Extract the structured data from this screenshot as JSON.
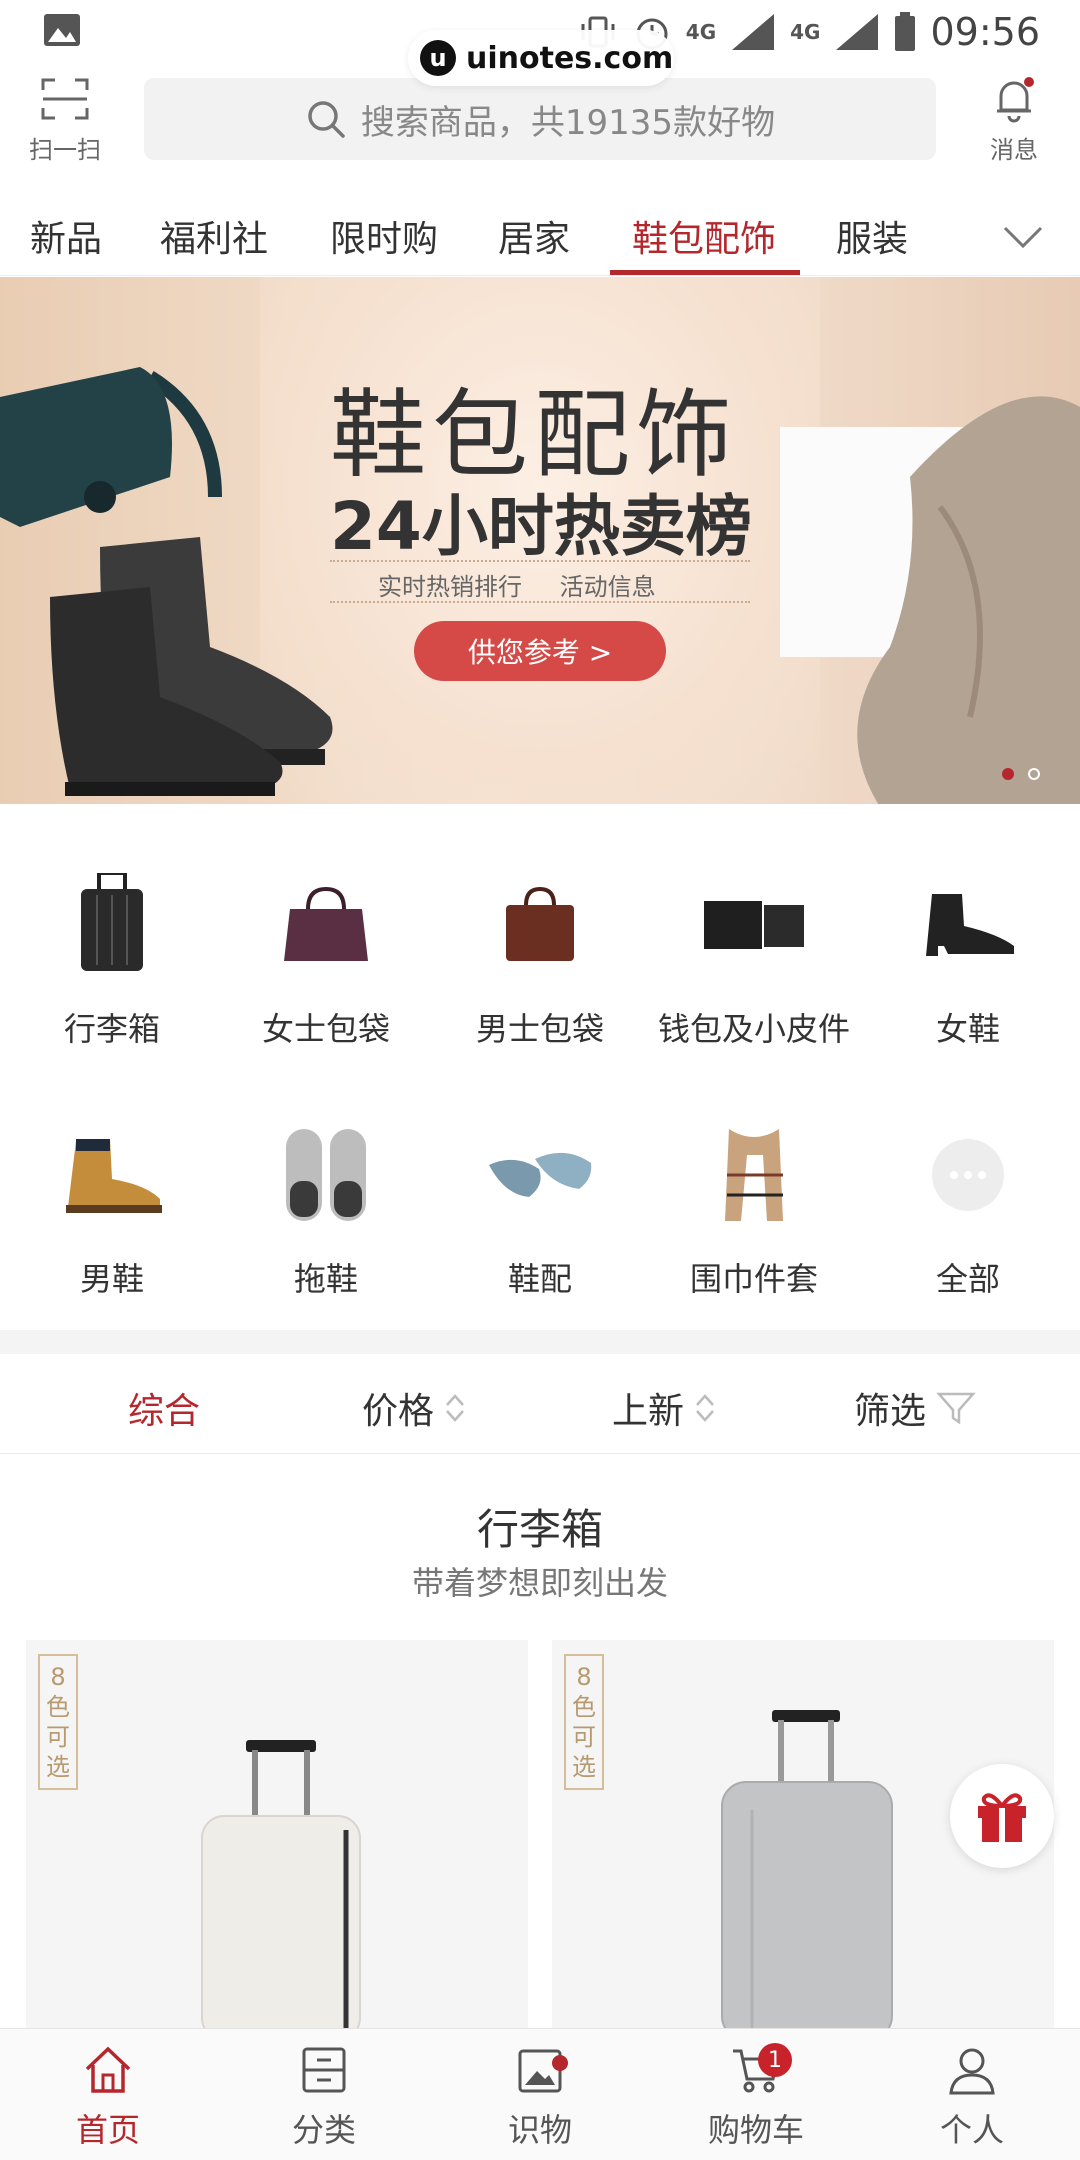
{
  "status_bar": {
    "time": "09:56",
    "network_1": "4G",
    "network_2": "4G"
  },
  "watermark": {
    "logo_letter": "u",
    "text": "uinotes.com"
  },
  "header": {
    "scan_label": "扫一扫",
    "search_placeholder": "搜索商品，共19135款好物",
    "message_label": "消息"
  },
  "tabs": [
    {
      "label": "新品"
    },
    {
      "label": "福利社"
    },
    {
      "label": "限时购"
    },
    {
      "label": "居家"
    },
    {
      "label": "鞋包配饰",
      "active": true
    },
    {
      "label": "服装"
    }
  ],
  "banner": {
    "title": "鞋包配饰",
    "subtitle": "24小时热卖榜",
    "info_1": "实时热销排行",
    "info_2": "活动信息",
    "button": "供您参考 >",
    "page_count": 2,
    "active_page": 1
  },
  "categories": [
    {
      "label": "行李箱",
      "icon": "luggage-icon"
    },
    {
      "label": "女士包袋",
      "icon": "handbag-icon"
    },
    {
      "label": "男士包袋",
      "icon": "briefcase-icon"
    },
    {
      "label": "钱包及小皮件",
      "icon": "wallet-icon"
    },
    {
      "label": "女鞋",
      "icon": "ankle-boot-icon"
    },
    {
      "label": "男鞋",
      "icon": "work-boot-icon"
    },
    {
      "label": "拖鞋",
      "icon": "slipper-icon"
    },
    {
      "label": "鞋配",
      "icon": "insole-icon"
    },
    {
      "label": "围巾件套",
      "icon": "scarf-icon"
    },
    {
      "label": "全部",
      "icon": "more-icon"
    }
  ],
  "sort": {
    "comprehensive": "综合",
    "price": "价格",
    "new": "上新",
    "filter": "筛选"
  },
  "section": {
    "title": "行李箱",
    "subtitle": "带着梦想即刻出发"
  },
  "products": [
    {
      "color_tag": [
        "8",
        "色",
        "可",
        "选"
      ],
      "color": "#efede8"
    },
    {
      "color_tag": [
        "8",
        "色",
        "可",
        "选"
      ],
      "color": "#c2c4c6"
    }
  ],
  "bottom_nav": [
    {
      "label": "首页",
      "icon": "home-icon",
      "active": true
    },
    {
      "label": "分类",
      "icon": "category-icon"
    },
    {
      "label": "识物",
      "icon": "discover-icon",
      "dot": true
    },
    {
      "label": "购物车",
      "icon": "cart-icon",
      "badge": "1"
    },
    {
      "label": "个人",
      "icon": "profile-icon"
    }
  ],
  "colors": {
    "accent": "#b4282d",
    "banner_button": "#d54a46"
  }
}
